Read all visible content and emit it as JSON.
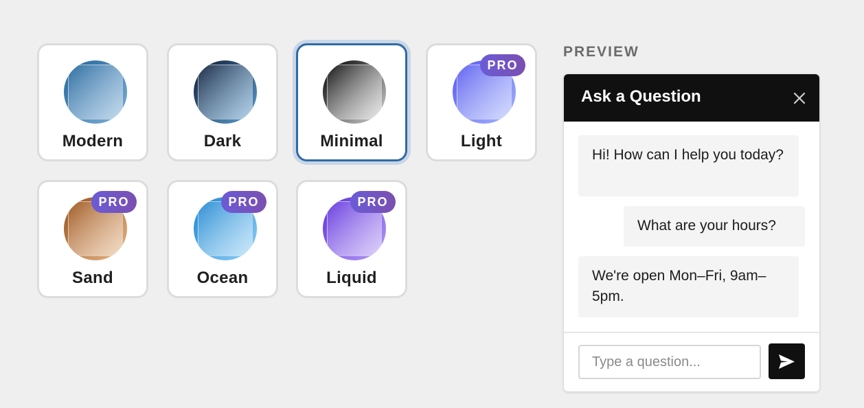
{
  "themes": [
    {
      "name": "Modern",
      "pro": false,
      "selected": false,
      "colors": [
        "#2f6fa3",
        "#7fb0d9"
      ]
    },
    {
      "name": "Dark",
      "pro": false,
      "selected": false,
      "colors": [
        "#1b2f4d",
        "#5b9fd3"
      ]
    },
    {
      "name": "Minimal",
      "pro": false,
      "selected": true,
      "colors": [
        "#1e1e1e",
        "#d8d8d8"
      ]
    },
    {
      "name": "Light",
      "pro": true,
      "selected": false,
      "colors": [
        "#6366f1",
        "#a5b4fc"
      ]
    },
    {
      "name": "Sand",
      "pro": true,
      "selected": false,
      "colors": [
        "#a35e28",
        "#e8b88a"
      ]
    },
    {
      "name": "Ocean",
      "pro": true,
      "selected": false,
      "colors": [
        "#2f8fd6",
        "#90d0f5"
      ]
    },
    {
      "name": "Liquid",
      "pro": true,
      "selected": false,
      "colors": [
        "#6b3fe0",
        "#b69cf5"
      ]
    }
  ],
  "pro_label": "PRO",
  "preview": {
    "label": "PREVIEW",
    "title": "Ask a Question",
    "messages": [
      {
        "from": "bot",
        "text": "Hi! How can I help you today?"
      },
      {
        "from": "user",
        "text": "What are your hours?"
      },
      {
        "from": "bot",
        "text": "We're open Mon–Fri, 9am–5pm."
      }
    ],
    "input_placeholder": "Type a question..."
  }
}
